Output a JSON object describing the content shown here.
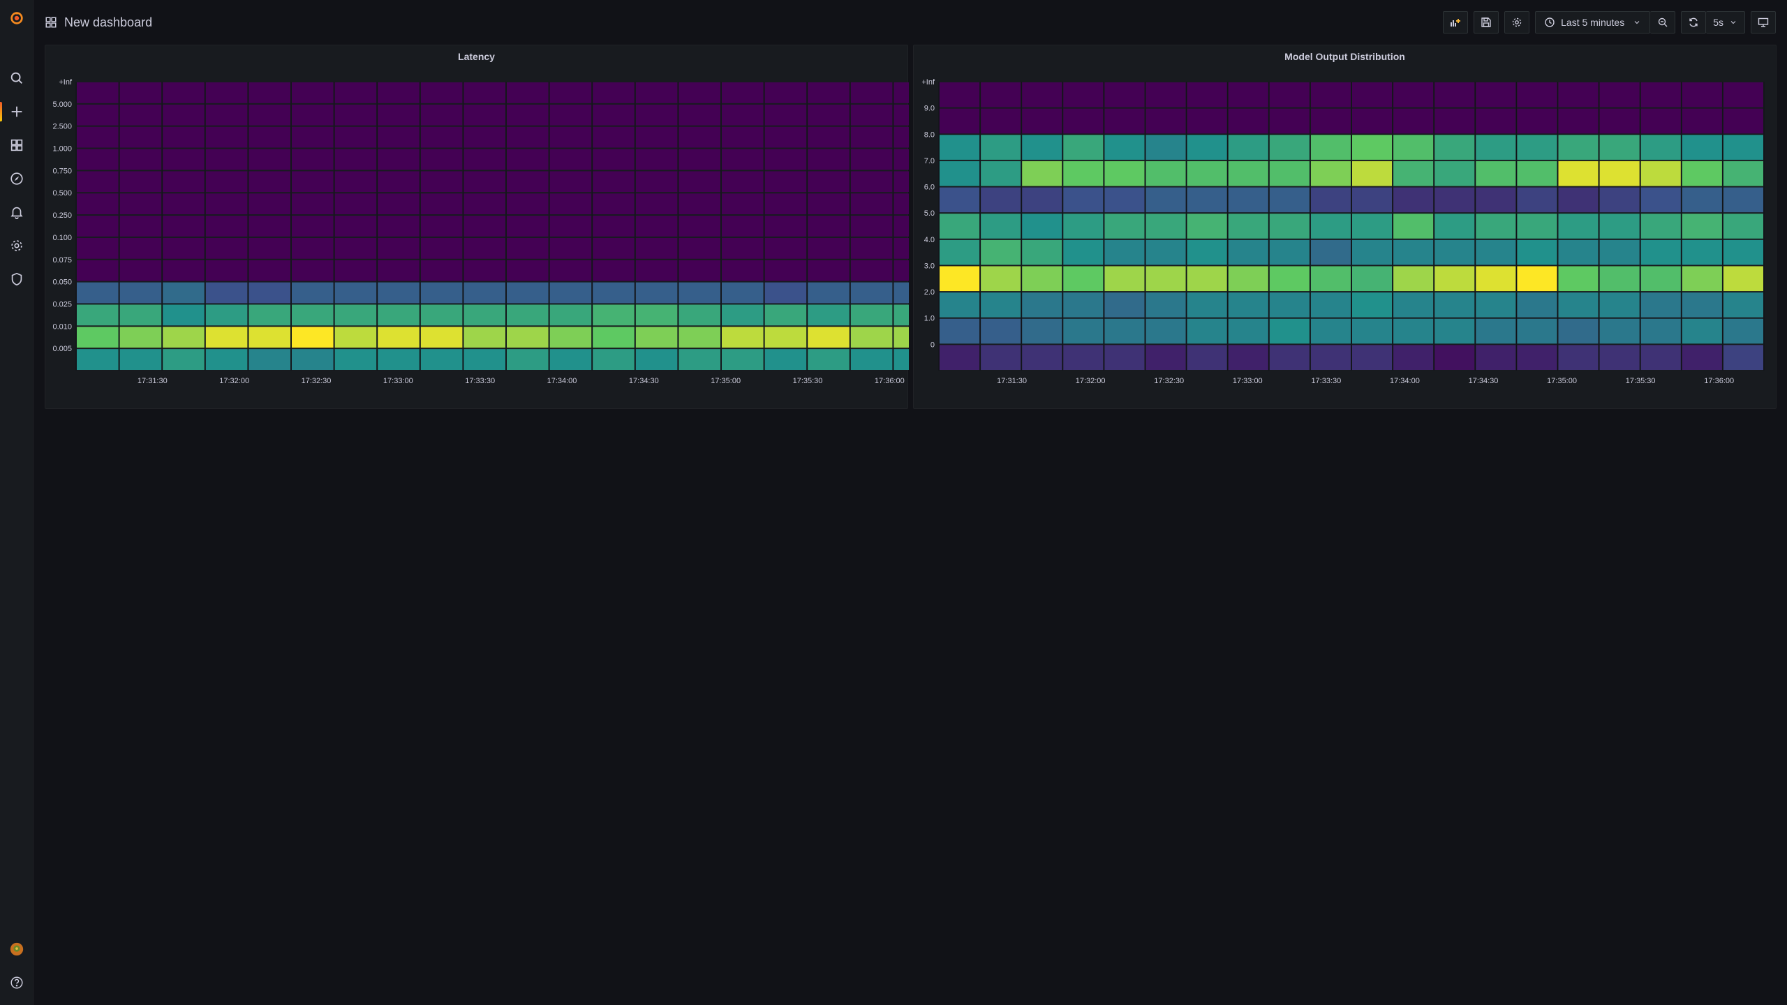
{
  "dashboard": {
    "title": "New dashboard"
  },
  "toolbar": {
    "time_range_label": "Last 5 minutes",
    "refresh_interval_label": "5s"
  },
  "colors": {
    "background": "#111217",
    "panel": "#181b1f",
    "accent": "#f05a28",
    "scale_low": "#440154",
    "scale_high": "#fde725"
  },
  "sidemenu": {
    "icons": [
      "grafana-logo-icon",
      "search-icon",
      "plus-icon",
      "dashboards-icon",
      "explore-compass-icon",
      "alerting-bell-icon",
      "gear-icon",
      "shield-icon",
      "user-avatar",
      "help-icon"
    ]
  },
  "chart_data": [
    {
      "type": "heatmap",
      "title": "Latency",
      "color_scale": "viridis (low = dark purple, high = yellow)",
      "y_buckets": [
        "+Inf",
        "5.000",
        "2.500",
        "1.000",
        "0.750",
        "0.500",
        "0.250",
        "0.100",
        "0.075",
        "0.050",
        "0.025",
        "0.010",
        "0.005"
      ],
      "x_ticks": [
        "17:31:30",
        "17:32:00",
        "17:32:30",
        "17:33:00",
        "17:33:30",
        "17:34:00",
        "17:34:30",
        "17:35:00",
        "17:35:30",
        "17:36:00"
      ],
      "columns": 20,
      "cells": [
        [
          0,
          0,
          0,
          0,
          0,
          0,
          0,
          0,
          0,
          0,
          0,
          0,
          0,
          0,
          0,
          0,
          0,
          0,
          0,
          0
        ],
        [
          0,
          0,
          0,
          0,
          0,
          0,
          0,
          0,
          0,
          0,
          0,
          0,
          0,
          0,
          0,
          0,
          0,
          0,
          0,
          0
        ],
        [
          0,
          0,
          0,
          0,
          0,
          0,
          0,
          0,
          0,
          0,
          0,
          0,
          0,
          0,
          0,
          0,
          0,
          0,
          0,
          0
        ],
        [
          0,
          0,
          0,
          0,
          0,
          0,
          0,
          0,
          0,
          0,
          0,
          0,
          0,
          0,
          0,
          0,
          0,
          0,
          0,
          0
        ],
        [
          0,
          0,
          0,
          0,
          0,
          0,
          0,
          0,
          0,
          0,
          0,
          0,
          0,
          0,
          0,
          0,
          0,
          0,
          0,
          0
        ],
        [
          0,
          0,
          0,
          0,
          0,
          0,
          0,
          0,
          0,
          0,
          0,
          0,
          0,
          0,
          0,
          0,
          0,
          0,
          0,
          0
        ],
        [
          0,
          0,
          0,
          0,
          0,
          0,
          0,
          0,
          0,
          0,
          0,
          0,
          0,
          0,
          0,
          0,
          0,
          0,
          0,
          0
        ],
        [
          0,
          0,
          0,
          0,
          0,
          0,
          0,
          0,
          0,
          0,
          0,
          0,
          0,
          0,
          0,
          0,
          0,
          0,
          0,
          0
        ],
        [
          0,
          0,
          0,
          0,
          0,
          0,
          0,
          0,
          0,
          0,
          0,
          0,
          0,
          0,
          0,
          0,
          0,
          0,
          0,
          0
        ],
        [
          0.3,
          0.3,
          0.35,
          0.25,
          0.25,
          0.3,
          0.3,
          0.3,
          0.3,
          0.3,
          0.3,
          0.3,
          0.3,
          0.3,
          0.3,
          0.3,
          0.25,
          0.3,
          0.3,
          0.3
        ],
        [
          0.6,
          0.6,
          0.5,
          0.55,
          0.6,
          0.6,
          0.6,
          0.6,
          0.6,
          0.6,
          0.6,
          0.6,
          0.65,
          0.65,
          0.6,
          0.55,
          0.6,
          0.55,
          0.6,
          0.6
        ],
        [
          0.75,
          0.8,
          0.85,
          0.95,
          0.95,
          1.0,
          0.9,
          0.95,
          0.95,
          0.85,
          0.85,
          0.8,
          0.75,
          0.8,
          0.8,
          0.9,
          0.9,
          0.95,
          0.85,
          0.85
        ],
        [
          0.5,
          0.5,
          0.55,
          0.5,
          0.45,
          0.45,
          0.5,
          0.5,
          0.5,
          0.5,
          0.55,
          0.5,
          0.55,
          0.5,
          0.55,
          0.55,
          0.5,
          0.55,
          0.5,
          0.5
        ]
      ]
    },
    {
      "type": "heatmap",
      "title": "Model Output Distribution",
      "color_scale": "viridis (low = dark purple, high = yellow)",
      "y_buckets": [
        "+Inf",
        "9.0",
        "8.0",
        "7.0",
        "6.0",
        "5.0",
        "4.0",
        "3.0",
        "2.0",
        "1.0",
        "0"
      ],
      "x_ticks": [
        "17:31:30",
        "17:32:00",
        "17:32:30",
        "17:33:00",
        "17:33:30",
        "17:34:00",
        "17:34:30",
        "17:35:00",
        "17:35:30",
        "17:36:00"
      ],
      "columns": 20,
      "cells": [
        [
          0,
          0,
          0,
          0,
          0,
          0,
          0,
          0,
          0,
          0,
          0,
          0,
          0,
          0,
          0,
          0,
          0,
          0,
          0,
          0
        ],
        [
          0,
          0,
          0,
          0,
          0,
          0,
          0,
          0,
          0,
          0,
          0,
          0,
          0,
          0,
          0,
          0,
          0,
          0,
          0,
          0
        ],
        [
          0.5,
          0.55,
          0.5,
          0.6,
          0.5,
          0.45,
          0.5,
          0.55,
          0.6,
          0.7,
          0.75,
          0.7,
          0.6,
          0.55,
          0.55,
          0.6,
          0.6,
          0.55,
          0.5,
          0.5
        ],
        [
          0.5,
          0.55,
          0.8,
          0.75,
          0.75,
          0.7,
          0.7,
          0.7,
          0.7,
          0.8,
          0.9,
          0.65,
          0.6,
          0.7,
          0.7,
          0.95,
          0.95,
          0.9,
          0.75,
          0.65
        ],
        [
          0.25,
          0.2,
          0.2,
          0.25,
          0.25,
          0.3,
          0.3,
          0.3,
          0.3,
          0.2,
          0.2,
          0.15,
          0.15,
          0.15,
          0.2,
          0.15,
          0.2,
          0.25,
          0.3,
          0.3
        ],
        [
          0.6,
          0.55,
          0.5,
          0.55,
          0.6,
          0.6,
          0.65,
          0.6,
          0.6,
          0.55,
          0.55,
          0.7,
          0.55,
          0.6,
          0.6,
          0.55,
          0.55,
          0.6,
          0.65,
          0.6
        ],
        [
          0.55,
          0.65,
          0.6,
          0.5,
          0.45,
          0.45,
          0.5,
          0.45,
          0.45,
          0.35,
          0.45,
          0.45,
          0.45,
          0.45,
          0.5,
          0.45,
          0.45,
          0.5,
          0.5,
          0.5
        ],
        [
          1.0,
          0.85,
          0.8,
          0.75,
          0.85,
          0.85,
          0.85,
          0.8,
          0.75,
          0.7,
          0.65,
          0.85,
          0.9,
          0.95,
          1.0,
          0.75,
          0.7,
          0.7,
          0.8,
          0.9
        ],
        [
          0.45,
          0.45,
          0.4,
          0.4,
          0.35,
          0.4,
          0.45,
          0.45,
          0.45,
          0.45,
          0.5,
          0.45,
          0.45,
          0.45,
          0.4,
          0.45,
          0.45,
          0.4,
          0.4,
          0.45
        ],
        [
          0.3,
          0.3,
          0.35,
          0.4,
          0.4,
          0.4,
          0.45,
          0.45,
          0.5,
          0.45,
          0.45,
          0.45,
          0.45,
          0.4,
          0.4,
          0.35,
          0.4,
          0.4,
          0.45,
          0.4
        ],
        [
          0.1,
          0.15,
          0.15,
          0.15,
          0.15,
          0.1,
          0.15,
          0.1,
          0.15,
          0.15,
          0.15,
          0.1,
          0.05,
          0.1,
          0.1,
          0.15,
          0.15,
          0.15,
          0.1,
          0.2
        ]
      ]
    }
  ]
}
